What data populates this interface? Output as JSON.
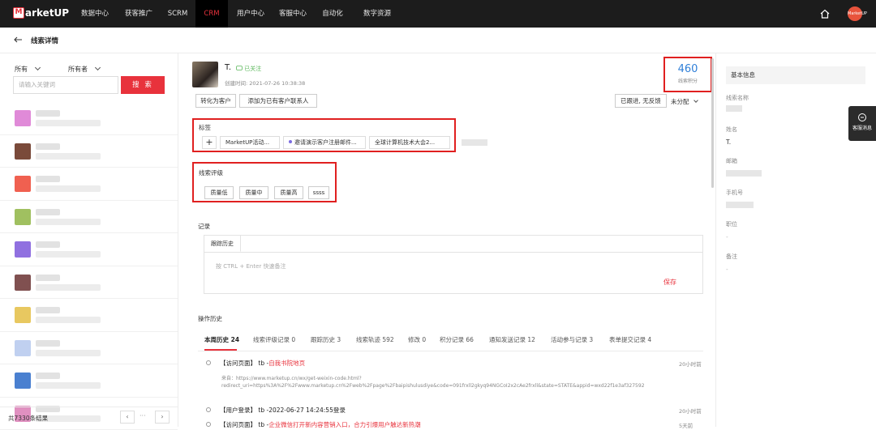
{
  "topnav": {
    "brand": "arketUP",
    "brand_mark": "M",
    "items": [
      "数据中心",
      "获客推广",
      "SCRM",
      "CRM",
      "用户中心",
      "客服中心",
      "自动化",
      "数字资源"
    ],
    "active": "CRM",
    "avatar_text": "MarketUP"
  },
  "subheader": {
    "title": "线索详情"
  },
  "left": {
    "filter1": "所有",
    "filter2": "所有者",
    "search_placeholder": "请输入关键词",
    "search_button": "搜 索",
    "total": "共7330条结果",
    "prev": "‹",
    "next": "›",
    "dots": "···",
    "avatar_colors": [
      "#e08ad8",
      "#7a4a3a",
      "#f06050",
      "#a0c060",
      "#9070e0",
      "#805050",
      "#e8c860",
      "#c0d0f0",
      "#4a80d0",
      "#e090c0"
    ]
  },
  "lead": {
    "name": "T.",
    "follow": "已关注",
    "created": "创建时间: 2021-07-26 10:38:38",
    "btn_convert": "转化为客户",
    "btn_add_contact": "添加为已有客户联系人",
    "score": "460",
    "score_label": "线索积分",
    "status": "已跟进, 无反馈",
    "assign": "未分配"
  },
  "tags": {
    "title": "标签",
    "plus": "+",
    "items": [
      "MarketUP活动...",
      "邀请演示客户注册邮件...",
      "全球计算机技术大会2..."
    ]
  },
  "rating": {
    "title": "线索评级",
    "items": [
      "质量低",
      "质量中",
      "质量高",
      "ssss"
    ]
  },
  "record": {
    "title": "记录",
    "tab": "跟踪历史",
    "hint": "按 CTRL + Enter 快速备注",
    "save": "保存"
  },
  "history": {
    "title": "操作历史",
    "tabs": [
      "本周历史 24",
      "线索评级记录 0",
      "跟踪历史 3",
      "线索轨迹 592",
      "修改 0",
      "积分记录 66",
      "通知发送记录 12",
      "活动参与记录 3",
      "表单提交记录 4"
    ],
    "events": [
      {
        "type": "【访问页面】",
        "who": " tb -",
        "what": "自我书院地页",
        "time": "20小时前",
        "src1": "来自：https://www.marketup.cn/wx/get-weixin-code.html?",
        "src2": "redirect_uri=https%3A%2F%2Fwww.marketup.cn%2Fweb%2Fpage%2Fbaipishulusdiye&code=091frxll2gkyq94NGCoI2x2cAe2frxll&state=STATE&appid=wxd22f1e3af327592"
      },
      {
        "type": "【用户登录】",
        "who": " tb -",
        "what": "2022-06-27 14:24:55登录",
        "time": "20小时前"
      },
      {
        "type": "【访问页面】",
        "who": " tb -",
        "what": "企业微信打开新内容营销入口，合力引爆用户触达新热潮",
        "time": "5天前"
      }
    ]
  },
  "right": {
    "header": "基本信息",
    "fields": [
      {
        "label": "线索名称",
        "value": ""
      },
      {
        "label": "姓名",
        "value": "T."
      },
      {
        "label": "邮箱",
        "value": ""
      },
      {
        "label": "手机号",
        "value": ""
      },
      {
        "label": "职位",
        "value": "-"
      },
      {
        "label": "备注",
        "value": "-"
      }
    ]
  },
  "float": {
    "label": "客服消息"
  }
}
